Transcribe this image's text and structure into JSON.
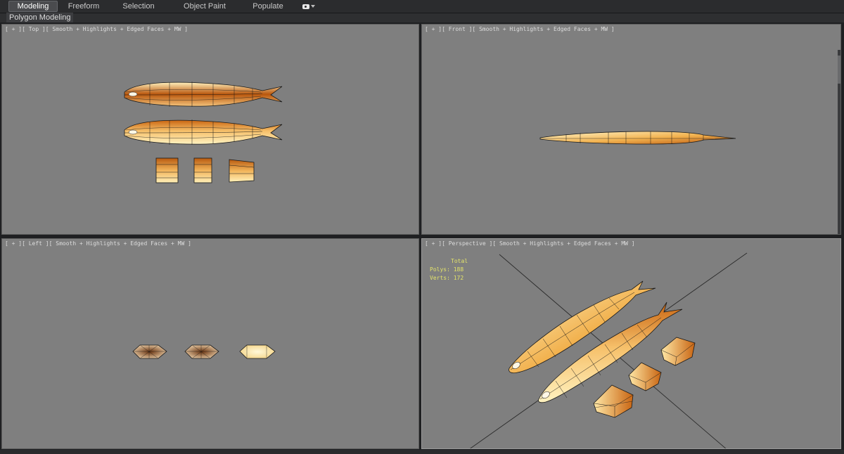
{
  "ribbon": {
    "tabs": [
      {
        "label": "Modeling",
        "active": true
      },
      {
        "label": "Freeform",
        "active": false
      },
      {
        "label": "Selection",
        "active": false
      },
      {
        "label": "Object Paint",
        "active": false
      },
      {
        "label": "Populate",
        "active": false
      }
    ],
    "extra_icon": "camera-dropdown-icon"
  },
  "subbar": {
    "panel_label": "Polygon Modeling"
  },
  "viewports": {
    "top": {
      "label": "[ + ][ Top ][ Smooth + Highlights + Edged Faces + MW ]"
    },
    "front": {
      "label": "[ + ][ Front ][ Smooth + Highlights + Edged Faces + MW ]"
    },
    "left": {
      "label": "[ + ][ Left ][ Smooth + Highlights + Edged Faces + MW ]"
    },
    "perspective": {
      "label": "[ + ][ Perspective ][ Smooth + Highlights + Edged Faces + MW ]",
      "stats": {
        "header": "Total",
        "polys_label": "Polys:",
        "polys": "188",
        "verts_label": "Verts:",
        "verts": "172"
      }
    }
  },
  "colors": {
    "viewport_bg": "#7f7f7f",
    "fish_light": "#fff0b8",
    "fish_dark": "#c96512",
    "stats_text": "#e3e36a"
  }
}
